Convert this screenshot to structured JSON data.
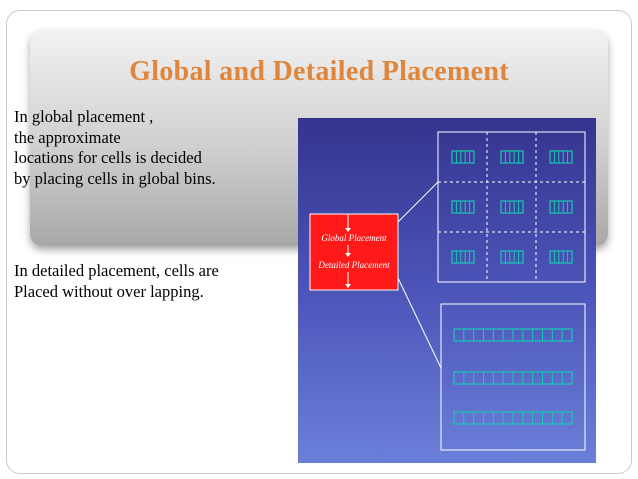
{
  "slide": {
    "title": "Global and Detailed Placement",
    "paragraph1": {
      "lines": [
        "In global placement ,",
        "the approximate",
        "locations for cells is decided",
        "by placing cells in global bins."
      ]
    },
    "paragraph2": {
      "lines": [
        "In detailed placement, cells are",
        "Placed without over lapping."
      ]
    }
  },
  "figure": {
    "flow_box_labels": [
      "Global Placement",
      "Detailed Placement"
    ],
    "colors": {
      "flow_box": "#ff1a1a",
      "cell": "#19c8b4",
      "grid_line": "#ffffff",
      "background": "#4b55b8"
    }
  }
}
